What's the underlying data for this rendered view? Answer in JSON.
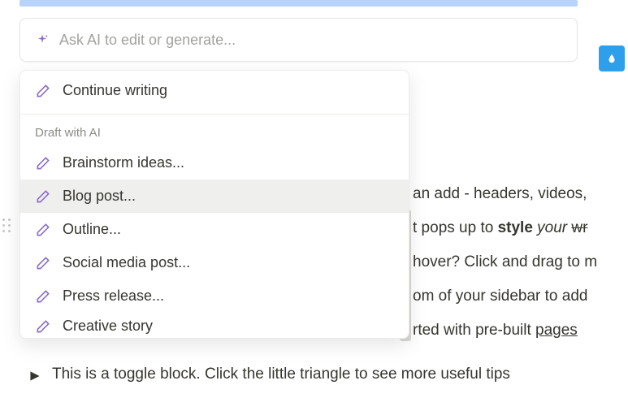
{
  "ai_input": {
    "placeholder": "Ask AI to edit or generate..."
  },
  "dropdown": {
    "continue_label": "Continue writing",
    "section_header": "Draft with AI",
    "items": [
      {
        "label": "Brainstorm ideas..."
      },
      {
        "label": "Blog post..."
      },
      {
        "label": "Outline..."
      },
      {
        "label": "Social media post..."
      },
      {
        "label": "Press release..."
      },
      {
        "label": "Creative story"
      }
    ]
  },
  "bg": {
    "line1_a": "an add - headers, videos, ",
    "line2_a": "t pops up to ",
    "line2_b": "style",
    "line2_c": " your ",
    "line2_d": "wr",
    "line3_a": "hover? Click and drag to m",
    "line4_a": "om of your sidebar to add",
    "line5_a": "rted with pre-built ",
    "line5_b": "pages"
  },
  "toggle": {
    "text": "This is a toggle block. Click the little triangle to see more useful tips"
  }
}
